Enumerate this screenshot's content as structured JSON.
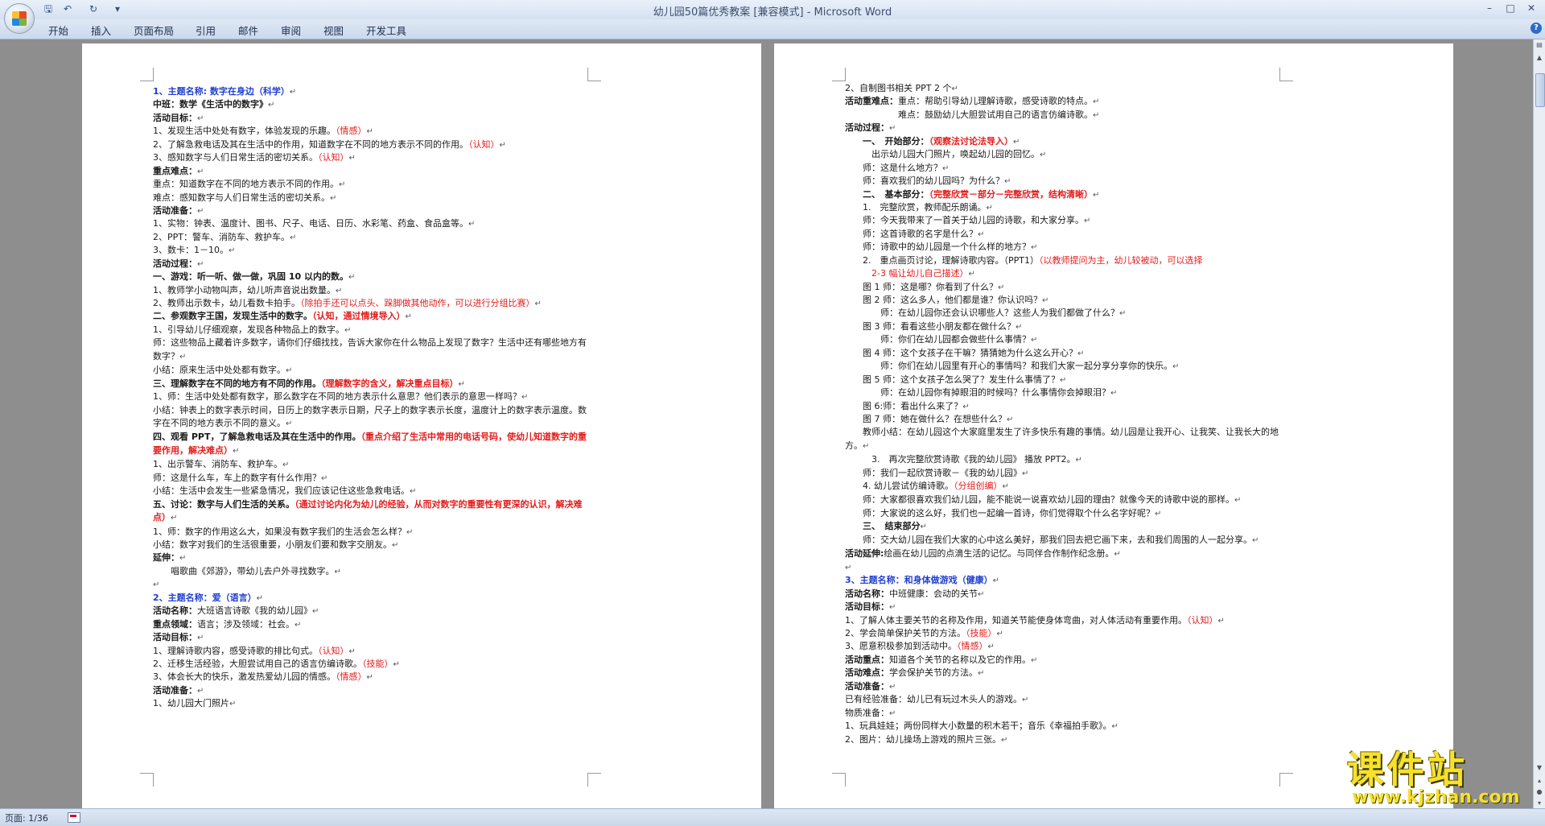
{
  "window": {
    "title": "幼儿园50篇优秀教案 [兼容模式]",
    "title_sep": " - ",
    "app_name": "Microsoft Word"
  },
  "quick_access": {
    "save_icon": "save-icon",
    "undo_icon": "undo-icon",
    "redo_icon": "redo-icon",
    "customize_icon": "dropdown-icon"
  },
  "ribbon": {
    "tabs": [
      "开始",
      "插入",
      "页面布局",
      "引用",
      "邮件",
      "审阅",
      "视图",
      "开发工具"
    ],
    "help_label": "?"
  },
  "status": {
    "page": "页面: 1/36"
  },
  "watermark": {
    "cn": "课件站",
    "url": "www.kjzhan.com"
  },
  "pages": [
    {
      "lines": [
        [
          {
            "t": "1、主题名称: 数字在身边（科学）",
            "c": "blue"
          },
          {
            "t": "↵",
            "c": "pm"
          }
        ],
        [
          {
            "t": "中班：数学《生活中的数字》",
            "c": "b"
          },
          {
            "t": "↵",
            "c": "pm"
          }
        ],
        [
          {
            "t": "活动目标：",
            "c": "b"
          },
          {
            "t": "↵",
            "c": "pm"
          }
        ],
        [
          {
            "t": "1、发现生活中处处有数字，体验发现的乐趣。"
          },
          {
            "t": "（情感）",
            "c": "red"
          },
          {
            "t": "↵",
            "c": "pm"
          }
        ],
        [
          {
            "t": "2、了解急救电话及其在生活中的作用，知道数字在不同的地方表示不同的作用。"
          },
          {
            "t": "（认知）",
            "c": "red"
          },
          {
            "t": "↵",
            "c": "pm"
          }
        ],
        [
          {
            "t": "3、感知数字与人们日常生活的密切关系。"
          },
          {
            "t": "（认知）",
            "c": "red"
          },
          {
            "t": "↵",
            "c": "pm"
          }
        ],
        [
          {
            "t": "重点难点：",
            "c": "b"
          },
          {
            "t": "↵",
            "c": "pm"
          }
        ],
        [
          {
            "t": "重点：知道数字在不同的地方表示不同的作用。"
          },
          {
            "t": "↵",
            "c": "pm"
          }
        ],
        [
          {
            "t": "难点：感知数字与人们日常生活的密切关系。"
          },
          {
            "t": "↵",
            "c": "pm"
          }
        ],
        [
          {
            "t": "活动准备：",
            "c": "b"
          },
          {
            "t": "↵",
            "c": "pm"
          }
        ],
        [
          {
            "t": "1、实物：钟表、温度计、图书、尺子、电话、日历、水彩笔、药盒、食品盒等。"
          },
          {
            "t": "↵",
            "c": "pm"
          }
        ],
        [
          {
            "t": "2、PPT：警车、消防车、救护车。"
          },
          {
            "t": "↵",
            "c": "pm"
          }
        ],
        [
          {
            "t": "3、数卡：1－10。"
          },
          {
            "t": "↵",
            "c": "pm"
          }
        ],
        [
          {
            "t": "活动过程：",
            "c": "b"
          },
          {
            "t": "↵",
            "c": "pm"
          }
        ],
        [
          {
            "t": "一、游戏：听一听、做一做，巩固 10 以内的数。",
            "c": "b"
          },
          {
            "t": "↵",
            "c": "pm"
          }
        ],
        [
          {
            "t": "1、教师学小动物叫声，幼儿听声音说出数量。"
          },
          {
            "t": "↵",
            "c": "pm"
          }
        ],
        [
          {
            "t": "2、教师出示数卡，幼儿看数卡拍手。"
          },
          {
            "t": "（除拍手还可以点头、跺脚做其他动作，可以进行分组比赛）",
            "c": "red"
          },
          {
            "t": "↵",
            "c": "pm"
          }
        ],
        [
          {
            "t": "二、参观数字王国，发现生活中的数字。",
            "c": "b"
          },
          {
            "t": "（认知，通过情境导入）",
            "c": "red b"
          },
          {
            "t": "↵",
            "c": "pm"
          }
        ],
        [
          {
            "t": "1、引导幼儿仔细观察，发现各种物品上的数字。"
          },
          {
            "t": "↵",
            "c": "pm"
          }
        ],
        [
          {
            "t": "师：这些物品上藏着许多数字，请你们仔细找找，告诉大家你在什么物品上发现了数字？生活中还有哪些地方有数字？",
            "wrap": true
          },
          {
            "t": "↵",
            "c": "pm"
          }
        ],
        [
          {
            "t": "小结：原来生活中处处都有数字。"
          },
          {
            "t": "↵",
            "c": "pm"
          }
        ],
        [
          {
            "t": "三、理解数字在不同的地方有不同的作用。",
            "c": "b"
          },
          {
            "t": "（理解数字的含义，解决重点目标）",
            "c": "red b"
          },
          {
            "t": "↵",
            "c": "pm"
          }
        ],
        [
          {
            "t": "1、师：生活中处处都有数字，那么数字在不同的地方表示什么意思？他们表示的意思一样吗？"
          },
          {
            "t": "↵",
            "c": "pm"
          }
        ],
        [
          {
            "t": "小结：钟表上的数字表示时间，日历上的数字表示日期，尺子上的数字表示长度，温度计上的数字表示温度。数字在不同的地方表示不同的意义。",
            "wrap": true
          },
          {
            "t": "↵",
            "c": "pm"
          }
        ],
        [
          {
            "t": "四、观看 PPT，了解急救电话及其在生活中的作用。",
            "c": "b"
          },
          {
            "t": "（重点介绍了生活中常用的电话号码，使幼儿知道数字的重要作用，解决难点）",
            "c": "red b",
            "wrap": true
          },
          {
            "t": "↵",
            "c": "pm"
          }
        ],
        [
          {
            "t": "1、出示警车、消防车、救护车。"
          },
          {
            "t": "↵",
            "c": "pm"
          }
        ],
        [
          {
            "t": "师：这是什么车，车上的数字有什么作用？"
          },
          {
            "t": "↵",
            "c": "pm"
          }
        ],
        [
          {
            "t": "小结：生活中会发生一些紧急情况，我们应该记住这些急救电话。"
          },
          {
            "t": "↵",
            "c": "pm"
          }
        ],
        [
          {
            "t": "五、讨论：数字与人们生活的关系。",
            "c": "b"
          },
          {
            "t": "（通过讨论内化为幼儿的经验，从而对数字的重要性有更深的认识，解决难点）",
            "c": "red b",
            "wrap": true
          },
          {
            "t": "↵",
            "c": "pm"
          }
        ],
        [
          {
            "t": "1、师：数字的作用这么大，如果没有数字我们的生活会怎么样？"
          },
          {
            "t": "↵",
            "c": "pm"
          }
        ],
        [
          {
            "t": "小结：数字对我们的生活很重要，小朋友们要和数字交朋友。"
          },
          {
            "t": "↵",
            "c": "pm"
          }
        ],
        [
          {
            "t": "延伸：",
            "c": "b"
          },
          {
            "t": "↵",
            "c": "pm"
          }
        ],
        [
          {
            "t": "　　唱歌曲《郊游》，带幼儿去户外寻找数字。"
          },
          {
            "t": "↵",
            "c": "pm"
          }
        ],
        [
          {
            "t": "↵",
            "c": "pm"
          }
        ],
        [
          {
            "t": "2、主题名称：爱（语言）",
            "c": "blue"
          },
          {
            "t": "↵",
            "c": "pm"
          }
        ],
        [
          {
            "t": "活动名称：",
            "c": "b"
          },
          {
            "t": "大班语言诗歌《我的幼儿园》"
          },
          {
            "t": "↵",
            "c": "pm"
          }
        ],
        [
          {
            "t": "重点领域：",
            "c": "b"
          },
          {
            "t": "语言；涉及领域：社会。"
          },
          {
            "t": "↵",
            "c": "pm"
          }
        ],
        [
          {
            "t": "活动目标：",
            "c": "b"
          },
          {
            "t": "↵",
            "c": "pm"
          }
        ],
        [
          {
            "t": "1、理解诗歌内容，感受诗歌的排比句式。"
          },
          {
            "t": "（认知）",
            "c": "red"
          },
          {
            "t": "↵",
            "c": "pm"
          }
        ],
        [
          {
            "t": "2、迁移生活经验，大胆尝试用自己的语言仿编诗歌。"
          },
          {
            "t": "（技能）",
            "c": "red"
          },
          {
            "t": "↵",
            "c": "pm"
          }
        ],
        [
          {
            "t": "3、体会长大的快乐，激发热爱幼儿园的情感。"
          },
          {
            "t": "（情感）",
            "c": "red"
          },
          {
            "t": "↵",
            "c": "pm"
          }
        ],
        [
          {
            "t": "活动准备：",
            "c": "b"
          },
          {
            "t": "↵",
            "c": "pm"
          }
        ],
        [
          {
            "t": "1、幼儿园大门照片"
          },
          {
            "t": "↵",
            "c": "pm"
          }
        ]
      ]
    },
    {
      "lines": [
        [
          {
            "t": "2、自制图书相关 PPT 2 个"
          },
          {
            "t": "↵",
            "c": "pm"
          }
        ],
        [
          {
            "t": "活动重难点：",
            "c": "b"
          },
          {
            "t": "重点：帮助引导幼儿理解诗歌，感受诗歌的特点。"
          },
          {
            "t": "↵",
            "c": "pm"
          }
        ],
        [
          {
            "t": "　　　　　　难点：鼓励幼儿大胆尝试用自己的语言仿编诗歌。"
          },
          {
            "t": "↵",
            "c": "pm"
          }
        ],
        [
          {
            "t": "活动过程：",
            "c": "b"
          },
          {
            "t": "↵",
            "c": "pm"
          }
        ],
        [
          {
            "t": "　　一、　开始部分：",
            "c": "b"
          },
          {
            "t": "（观察法讨论法导入）",
            "c": "red b"
          },
          {
            "t": "↵",
            "c": "pm"
          }
        ],
        [
          {
            "t": "　　　出示幼儿园大门照片，唤起幼儿园的回忆。"
          },
          {
            "t": "↵",
            "c": "pm"
          }
        ],
        [
          {
            "t": "　　师：这是什么地方？"
          },
          {
            "t": "↵",
            "c": "pm"
          }
        ],
        [
          {
            "t": "　　师：喜欢我们的幼儿园吗？为什么？"
          },
          {
            "t": "↵",
            "c": "pm"
          }
        ],
        [
          {
            "t": "　　二、　基本部分：",
            "c": "b"
          },
          {
            "t": "（完整欣赏－部分－完整欣赏，结构清晰）",
            "c": "red b"
          },
          {
            "t": "↵",
            "c": "pm"
          }
        ],
        [
          {
            "t": "　　1.　完整欣赏，教师配乐朗诵。"
          },
          {
            "t": "↵",
            "c": "pm"
          }
        ],
        [
          {
            "t": "　　师：今天我带来了一首关于幼儿园的诗歌，和大家分享。"
          },
          {
            "t": "↵",
            "c": "pm"
          }
        ],
        [
          {
            "t": "　　师：这首诗歌的名字是什么？"
          },
          {
            "t": "↵",
            "c": "pm"
          }
        ],
        [
          {
            "t": "　　师：诗歌中的幼儿园是一个什么样的地方？"
          },
          {
            "t": "↵",
            "c": "pm"
          }
        ],
        [
          {
            "t": "　　2.　重点画页讨论，理解诗歌内容。（PPT1）"
          },
          {
            "t": "（以教师提问为主，幼儿较被动，可以选择",
            "c": "red"
          }
        ],
        [
          {
            "t": "　　　2-3 幅让幼儿自己描述）",
            "c": "red"
          },
          {
            "t": "↵",
            "c": "pm"
          }
        ],
        [
          {
            "t": "　　图 1 师：这是哪？你看到了什么？"
          },
          {
            "t": "↵",
            "c": "pm"
          }
        ],
        [
          {
            "t": "　　图 2 师：这么多人，他们都是谁？你认识吗？"
          },
          {
            "t": "↵",
            "c": "pm"
          }
        ],
        [
          {
            "t": "　　　　师：在幼儿园你还会认识哪些人？这些人为我们都做了什么？"
          },
          {
            "t": "↵",
            "c": "pm"
          }
        ],
        [
          {
            "t": "　　图 3 师：看看这些小朋友都在做什么？"
          },
          {
            "t": "↵",
            "c": "pm"
          }
        ],
        [
          {
            "t": "　　　　师：你们在幼儿园都会做些什么事情？"
          },
          {
            "t": "↵",
            "c": "pm"
          }
        ],
        [
          {
            "t": "　　图 4 师：这个女孩子在干嘛？猜猜她为什么这么开心？"
          },
          {
            "t": "↵",
            "c": "pm"
          }
        ],
        [
          {
            "t": "　　　　师：你们在幼儿园里有开心的事情吗？和我们大家一起分享分享你的快乐。"
          },
          {
            "t": "↵",
            "c": "pm"
          }
        ],
        [
          {
            "t": "　　图 5 师：这个女孩子怎么哭了？发生什么事情了？"
          },
          {
            "t": "↵",
            "c": "pm"
          }
        ],
        [
          {
            "t": "　　　　师：在幼儿园你有掉眼泪的时候吗？什么事情你会掉眼泪？"
          },
          {
            "t": "↵",
            "c": "pm"
          }
        ],
        [
          {
            "t": "　　图 6:师：看出什么来了？"
          },
          {
            "t": "↵",
            "c": "pm"
          }
        ],
        [
          {
            "t": "　　图 7 师：她在做什么？在想些什么？"
          },
          {
            "t": "↵",
            "c": "pm"
          }
        ],
        [
          {
            "t": "　　教师小结：在幼儿园这个大家庭里发生了许多快乐有趣的事情。幼儿园是让我开心、让我笑、让我长大的地方。",
            "wrap": true
          },
          {
            "t": "↵",
            "c": "pm"
          }
        ],
        [
          {
            "t": "　　　3.　再次完整欣赏诗歌《我的幼儿园》 播放 PPT2。"
          },
          {
            "t": "↵",
            "c": "pm"
          }
        ],
        [
          {
            "t": "　　师：我们一起欣赏诗歌－《我的幼儿园》"
          },
          {
            "t": "↵",
            "c": "pm"
          }
        ],
        [
          {
            "t": "　　4. 幼儿尝试仿编诗歌。"
          },
          {
            "t": "（分组创编）",
            "c": "red"
          },
          {
            "t": "↵",
            "c": "pm"
          }
        ],
        [
          {
            "t": "　　师：大家都很喜欢我们幼儿园，能不能说一说喜欢幼儿园的理由？就像今天的诗歌中说的那样。",
            "wrap": true
          },
          {
            "t": "↵",
            "c": "pm"
          }
        ],
        [
          {
            "t": "　　师：大家说的这么好，我们也一起编一首诗，你们觉得取个什么名字好呢？"
          },
          {
            "t": "↵",
            "c": "pm"
          }
        ],
        [
          {
            "t": "　　三、　结束部分",
            "c": "b"
          },
          {
            "t": "↵",
            "c": "pm"
          }
        ],
        [
          {
            "t": "　　师：交大幼儿园在我们大家的心中这么美好，那我们回去把它画下来，去和我们周围的人一起分享。",
            "wrap": true
          },
          {
            "t": "↵",
            "c": "pm"
          }
        ],
        [
          {
            "t": "活动延伸:",
            "c": "b"
          },
          {
            "t": "绘画在幼儿园的点滴生活的记忆。与同伴合作制作纪念册。"
          },
          {
            "t": "↵",
            "c": "pm"
          }
        ],
        [
          {
            "t": "↵",
            "c": "pm"
          }
        ],
        [
          {
            "t": "3、主题名称：",
            "c": "blue"
          },
          {
            "t": "和身体做游戏（健康）",
            "c": "blue"
          },
          {
            "t": "↵",
            "c": "pm"
          }
        ],
        [
          {
            "t": "活动名称：",
            "c": "b"
          },
          {
            "t": "中班健康：会动的关节"
          },
          {
            "t": "↵",
            "c": "pm"
          }
        ],
        [
          {
            "t": "活动目标：",
            "c": "b"
          },
          {
            "t": "↵",
            "c": "pm"
          }
        ],
        [
          {
            "t": "1、了解人体主要关节的名称及作用，知道关节能使身体弯曲，对人体活动有重要作用。"
          },
          {
            "t": "（认知）",
            "c": "red"
          },
          {
            "t": "↵",
            "c": "pm"
          }
        ],
        [
          {
            "t": "2、学会简单保护关节的方法。"
          },
          {
            "t": "（技能）",
            "c": "red"
          },
          {
            "t": "↵",
            "c": "pm"
          }
        ],
        [
          {
            "t": "3、愿意积极参加到活动中。"
          },
          {
            "t": "（情感）",
            "c": "red"
          },
          {
            "t": "↵",
            "c": "pm"
          }
        ],
        [
          {
            "t": "活动重点：",
            "c": "b"
          },
          {
            "t": "知道各个关节的名称以及它的作用。"
          },
          {
            "t": "↵",
            "c": "pm"
          }
        ],
        [
          {
            "t": "活动难点：",
            "c": "b"
          },
          {
            "t": "学会保护关节的方法。"
          },
          {
            "t": "↵",
            "c": "pm"
          }
        ],
        [
          {
            "t": "活动准备：",
            "c": "b"
          },
          {
            "t": "↵",
            "c": "pm"
          }
        ],
        [
          {
            "t": "已有经验准备：幼儿已有玩过木头人的游戏。"
          },
          {
            "t": "↵",
            "c": "pm"
          }
        ],
        [
          {
            "t": "物质准备："
          },
          {
            "t": "↵",
            "c": "pm"
          }
        ],
        [
          {
            "t": "1、玩具娃娃；两份同样大小数量的积木若干；音乐《幸福拍手歌》。"
          },
          {
            "t": "↵",
            "c": "pm"
          }
        ],
        [
          {
            "t": "2、图片：幼儿操场上游戏的照片三张。"
          },
          {
            "t": "↵",
            "c": "pm"
          }
        ]
      ]
    }
  ]
}
